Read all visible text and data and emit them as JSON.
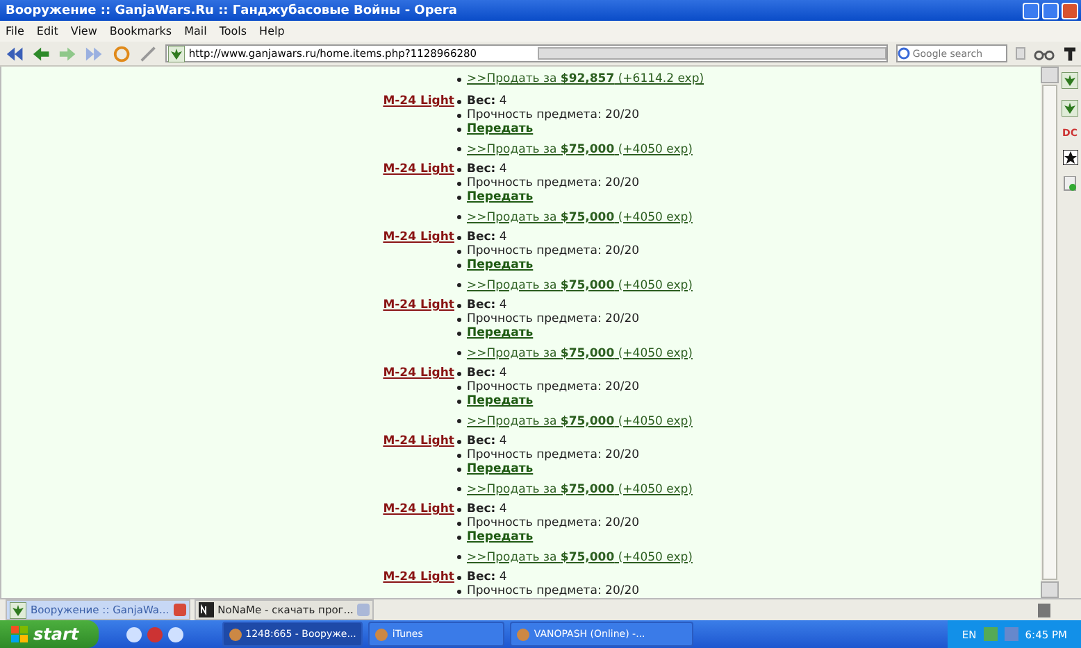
{
  "window": {
    "title": "Вооружение :: GanjaWars.Ru :: Ганджубасовые Войны - Opera"
  },
  "menu": [
    "File",
    "Edit",
    "View",
    "Bookmarks",
    "Mail",
    "Tools",
    "Help"
  ],
  "toolbar": {
    "address": "http://www.ganjawars.ru/home.items.php?1128966280",
    "search_placeholder": "Google search"
  },
  "side_panel": {
    "label": "DC"
  },
  "content": {
    "top_sell": ">>Продать за **$92,857** (+6114.2 exp)",
    "items": [
      {
        "name": "M-24 Light",
        "weight": "**Вес:** 4",
        "durability": "Прочность предмета: 20/20",
        "transfer": "Передать",
        "sell": ">>Продать за **$75,000** (+4050 exp)"
      },
      {
        "name": "M-24 Light",
        "weight": "**Вес:** 4",
        "durability": "Прочность предмета: 20/20",
        "transfer": "Передать",
        "sell": ">>Продать за **$75,000** (+4050 exp)"
      },
      {
        "name": "M-24 Light",
        "weight": "**Вес:** 4",
        "durability": "Прочность предмета: 20/20",
        "transfer": "Передать",
        "sell": ">>Продать за **$75,000** (+4050 exp)"
      },
      {
        "name": "M-24 Light",
        "weight": "**Вес:** 4",
        "durability": "Прочность предмета: 20/20",
        "transfer": "Передать",
        "sell": ">>Продать за **$75,000** (+4050 exp)"
      },
      {
        "name": "M-24 Light",
        "weight": "**Вес:** 4",
        "durability": "Прочность предмета: 20/20",
        "transfer": "Передать",
        "sell": ">>Продать за **$75,000** (+4050 exp)"
      },
      {
        "name": "M-24 Light",
        "weight": "**Вес:** 4",
        "durability": "Прочность предмета: 20/20",
        "transfer": "Передать",
        "sell": ">>Продать за **$75,000** (+4050 exp)"
      },
      {
        "name": "M-24 Light",
        "weight": "**Вес:** 4",
        "durability": "Прочность предмета: 20/20",
        "transfer": "Передать",
        "sell": ">>Продать за **$75,000** (+4050 exp)"
      },
      {
        "name": "M-24 Light",
        "weight": "**Вес:** 4",
        "durability": "Прочность предмета: 20/20"
      }
    ]
  },
  "tabs": [
    {
      "label": "Вооружение :: GanjaWa...",
      "selected": true
    },
    {
      "label": "NoNaMe - скачать прог...",
      "selected": false
    }
  ],
  "taskbar": {
    "start": "start",
    "tasks": [
      {
        "label": "1248:665 - Вооруже...",
        "selected": true
      },
      {
        "label": "iTunes",
        "selected": false
      },
      {
        "label": "VANOPASH (Online) -...",
        "selected": false
      }
    ],
    "language": "EN",
    "clock": "6:45 PM"
  }
}
